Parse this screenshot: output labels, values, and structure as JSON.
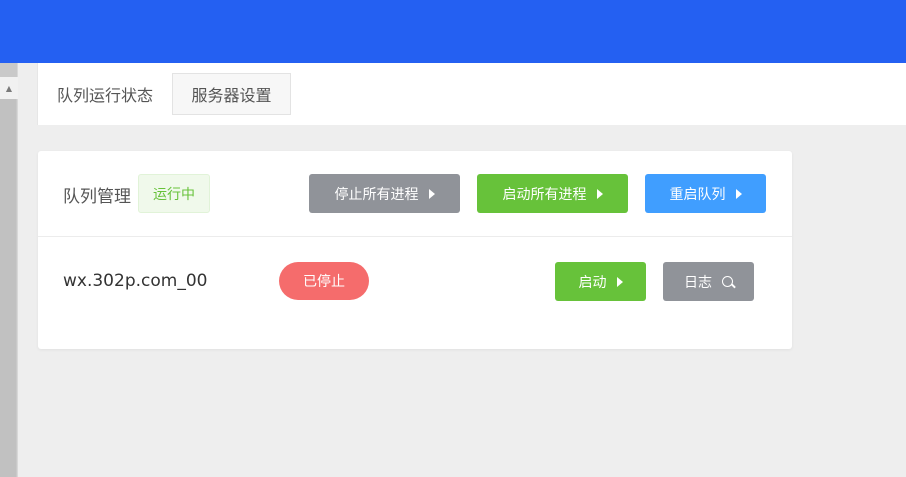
{
  "tabs": [
    {
      "label": "队列运行状态",
      "active": true
    },
    {
      "label": "服务器设置",
      "active": false
    }
  ],
  "queue": {
    "title": "队列管理",
    "status_badge": "运行中",
    "stop_all_label": "停止所有进程",
    "start_all_label": "启动所有进程",
    "restart_label": "重启队列"
  },
  "processes": [
    {
      "name": "wx.302p.com_00",
      "status": "已停止",
      "start_label": "启动",
      "log_label": "日志"
    }
  ],
  "colors": {
    "topbar": "#2460f2",
    "gray_button": "#909399",
    "green_button": "#67c23a",
    "blue_button": "#409eff",
    "stopped_pill": "#f56c6c",
    "running_badge_text": "#67c23a"
  },
  "icons": {
    "button_arrow": "caret-right-icon",
    "log_button": "search-icon"
  }
}
